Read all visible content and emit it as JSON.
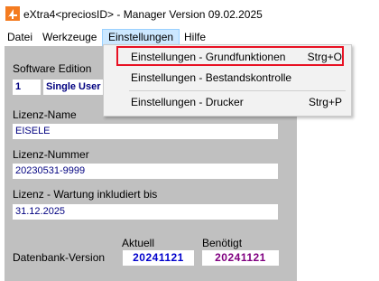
{
  "window": {
    "title": "eXtra4<preciosID> - Manager   Version 09.02.2025",
    "logo_color": "#f47b20"
  },
  "menubar": {
    "items": [
      "Datei",
      "Werkzeuge",
      "Einstellungen",
      "Hilfe"
    ]
  },
  "dropdown": {
    "items": [
      {
        "label": "Einstellungen - Grundfunktionen",
        "shortcut": "Strg+O"
      },
      {
        "label": "Einstellungen - Bestandskontrolle",
        "shortcut": ""
      },
      {
        "label": "Einstellungen - Drucker",
        "shortcut": "Strg+P"
      }
    ],
    "highlight_color": "#e81123"
  },
  "form": {
    "software_edition_label": "Software Edition",
    "edition_number": "1",
    "edition_name": "Single User",
    "lizenz_name_label": "Lizenz-Name",
    "lizenz_name_value": "EISELE",
    "lizenz_nummer_label": "Lizenz-Nummer",
    "lizenz_nummer_value": "20230531-9999",
    "wartung_label": "Lizenz - Wartung inkludiert bis",
    "wartung_value": "31.12.2025",
    "datenbank_label": "Datenbank-Version",
    "aktuell_label": "Aktuell",
    "aktuell_value": "20241121",
    "benoetigt_label": "Benötigt",
    "benoetigt_value": "20241121",
    "aktuell_color": "#0000cc",
    "benoetigt_color": "#800080"
  }
}
